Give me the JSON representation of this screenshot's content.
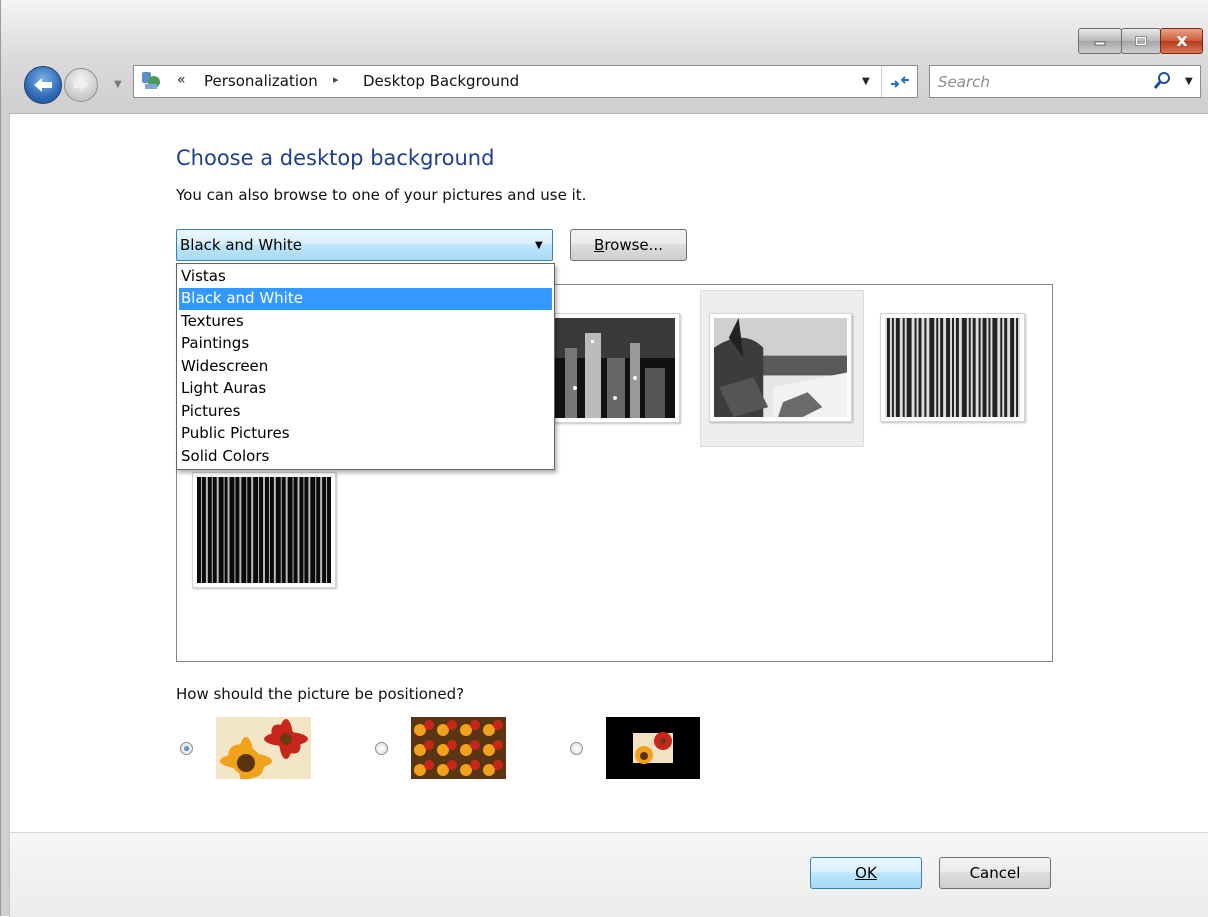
{
  "window": {
    "caption_buttons": [
      "minimize-icon",
      "maximize-icon",
      "close-icon"
    ]
  },
  "nav": {
    "back_icon": "back-arrow-icon",
    "forward_icon": "forward-arrow-icon",
    "history_icon": "chevron-down-icon"
  },
  "address": {
    "overflow": "«",
    "breadcrumbs": [
      "Personalization",
      "Desktop Background"
    ],
    "separator": "▸",
    "dropdown_icon": "chevron-down-icon",
    "refresh_icon": "refresh-icon"
  },
  "search": {
    "placeholder": "Search",
    "icon": "search-icon"
  },
  "content": {
    "title": "Choose a desktop background",
    "subtitle": "You can also browse to one of your pictures and use it.",
    "location_select": {
      "value": "Black and White",
      "options": [
        "Vistas",
        "Black and White",
        "Textures",
        "Paintings",
        "Widescreen",
        "Light Auras",
        "Pictures",
        "Public Pictures",
        "Solid Colors"
      ],
      "selected_index": 1
    },
    "browse_label": "Browse...",
    "position_question": "How should the picture be positioned?",
    "position_options": [
      "fit-to-screen",
      "tile",
      "center"
    ],
    "position_selected": 0
  },
  "footer": {
    "ok_label": "OK",
    "cancel_label": "Cancel"
  },
  "colors": {
    "title_blue": "#1e3f8a",
    "selection_blue": "#3399ff"
  }
}
